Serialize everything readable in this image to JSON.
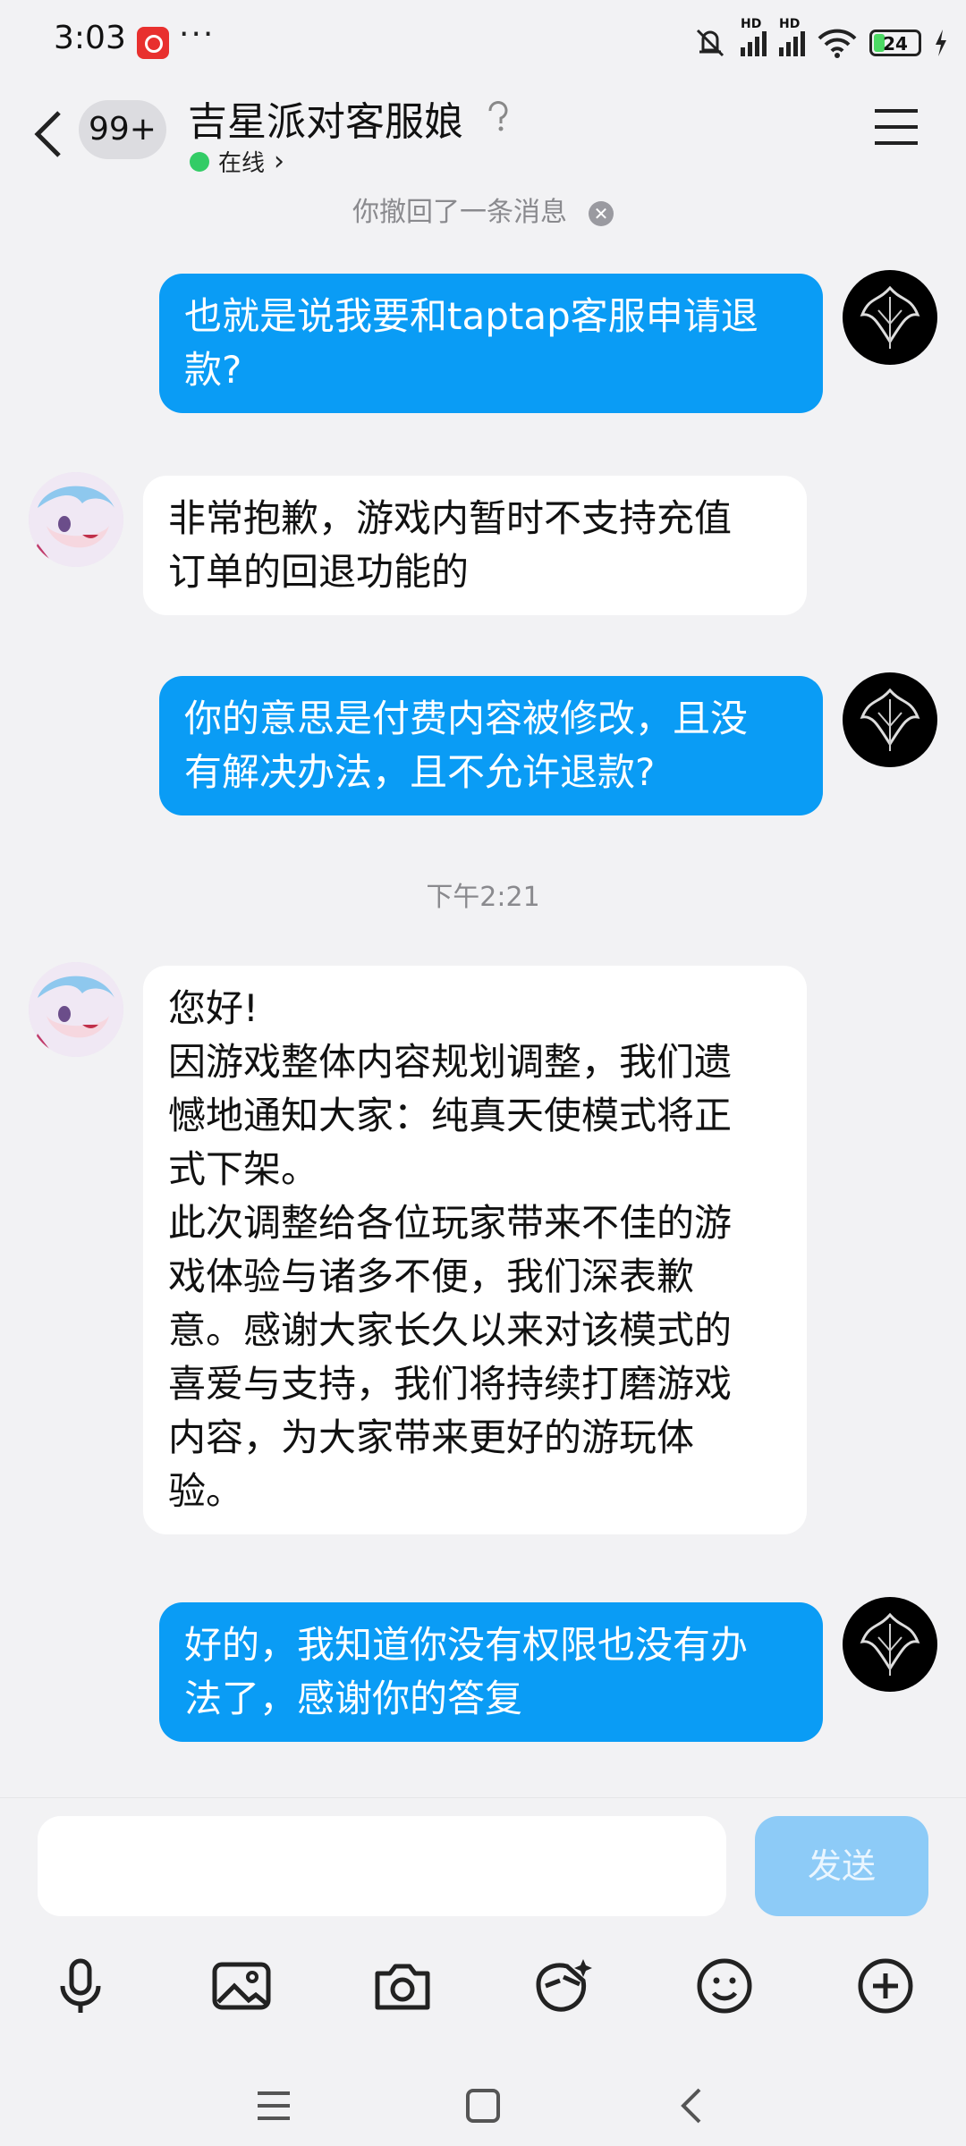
{
  "status_bar": {
    "time": "3:03",
    "more": "···",
    "signal1_label": "HD",
    "signal2_label": "HD",
    "battery": "24"
  },
  "header": {
    "badge": "99+",
    "title": "吉星派对客服娘",
    "status": "在线",
    "status_chevron": "›"
  },
  "chat": {
    "recall_notice": "你撤回了一条消息",
    "timestamp": "下午2:21",
    "messages": [
      {
        "from": "me",
        "lines": [
          "也就是说我要和taptap客服申请退",
          "款?"
        ]
      },
      {
        "from": "them",
        "lines": [
          "非常抱歉，游戏内暂时不支持充值",
          "订单的回退功能的"
        ]
      },
      {
        "from": "me",
        "lines": [
          "你的意思是付费内容被修改，且没",
          "有解决办法，且不允许退款?"
        ]
      },
      {
        "from": "them",
        "lines": [
          "您好!",
          "因游戏整体内容规划调整，我们遗",
          "憾地通知大家：纯真天使模式将正",
          "式下架。",
          "此次调整给各位玩家带来不佳的游",
          "戏体验与诸多不便，我们深表歉",
          "意。感谢大家长久以来对该模式的",
          "喜爱与支持，我们将持续打磨游戏",
          "内容，为大家带来更好的游玩体",
          "验。"
        ]
      },
      {
        "from": "me",
        "lines": [
          "好的，我知道你没有权限也没有办",
          "法了，感谢你的答复"
        ]
      }
    ]
  },
  "input": {
    "value": "",
    "send_label": "发送"
  },
  "toolbar": [
    "microphone-icon",
    "image-icon",
    "camera-icon",
    "sticker-icon",
    "emoji-icon",
    "plus-icon"
  ],
  "colors": {
    "my_bubble": "#0a9cf5",
    "their_bubble": "#ffffff",
    "send_disabled": "#8dcbf7",
    "online_dot": "#33cc66"
  }
}
